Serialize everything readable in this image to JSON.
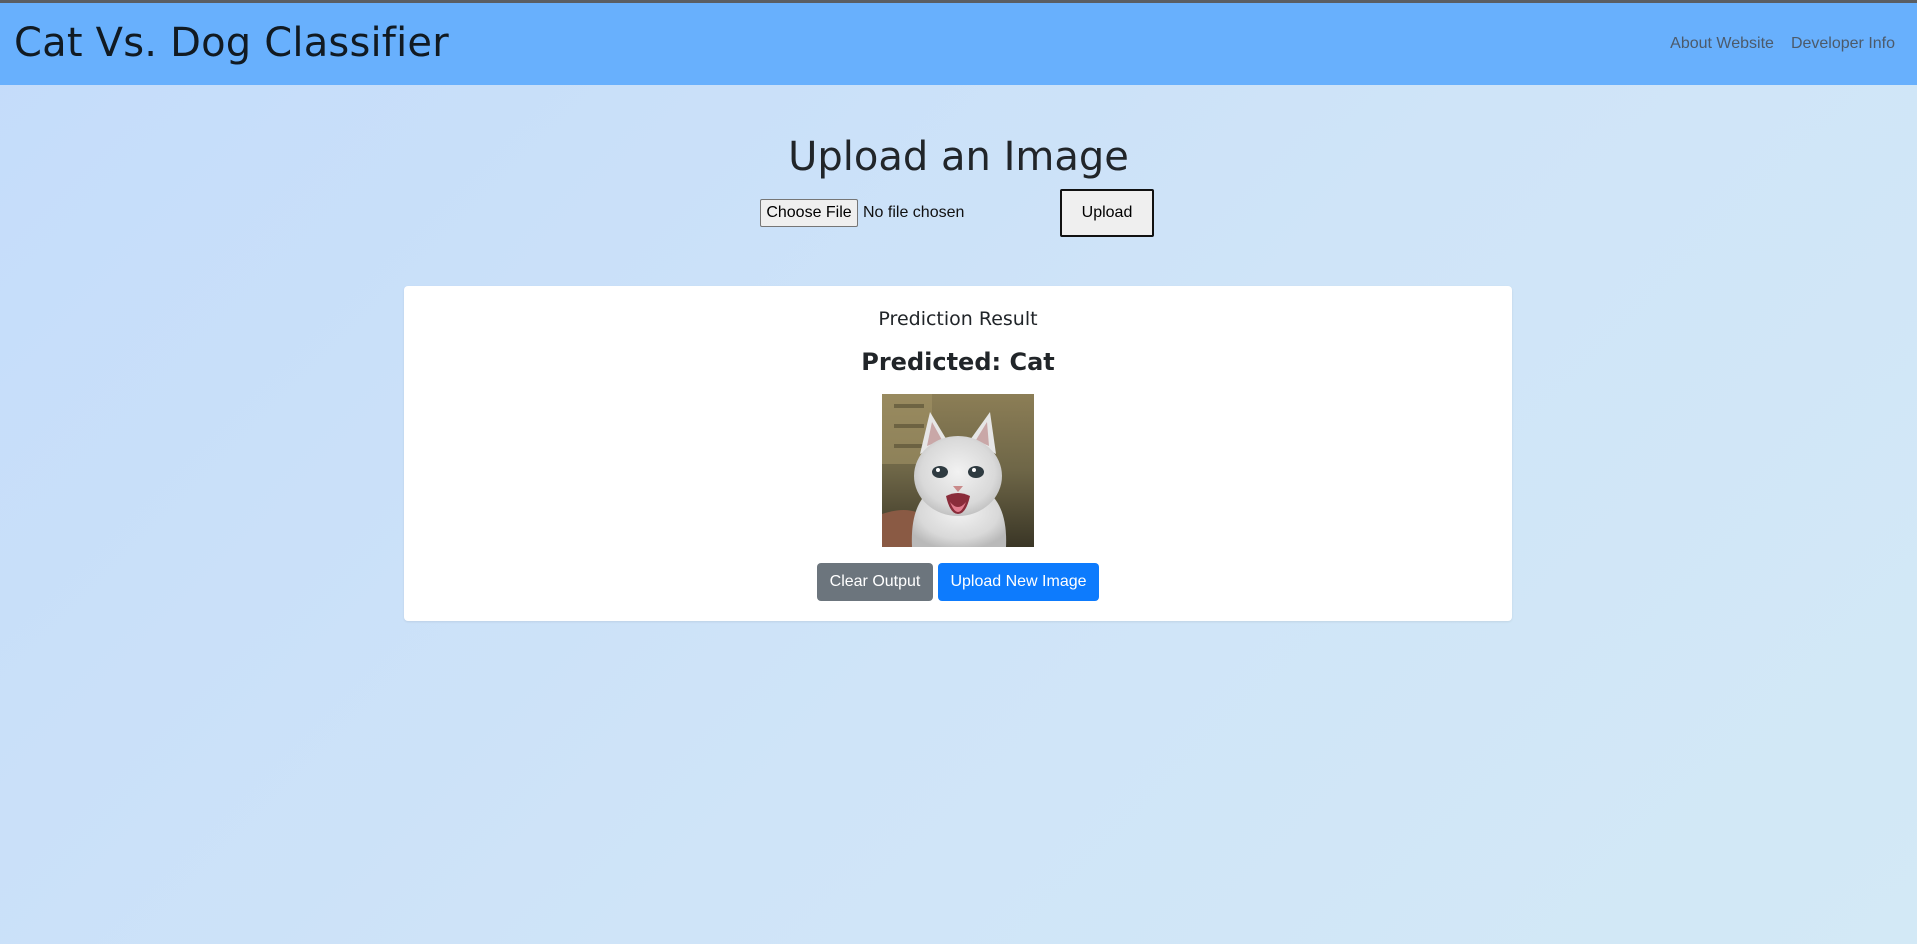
{
  "navbar": {
    "brand": "Cat Vs. Dog Classifier",
    "links": [
      "About Website",
      "Developer Info"
    ]
  },
  "upload": {
    "title": "Upload an Image",
    "choose_file_label": "Choose File",
    "file_status": "No file chosen",
    "upload_label": "Upload"
  },
  "result": {
    "title": "Prediction Result",
    "predicted": "Predicted: Cat",
    "image_subject": "white kitten photo",
    "clear_label": "Clear Output",
    "new_upload_label": "Upload New Image"
  },
  "colors": {
    "navbar": "#68b0fd",
    "primary_button": "#0d7bfd",
    "secondary_button": "#6c757d"
  }
}
